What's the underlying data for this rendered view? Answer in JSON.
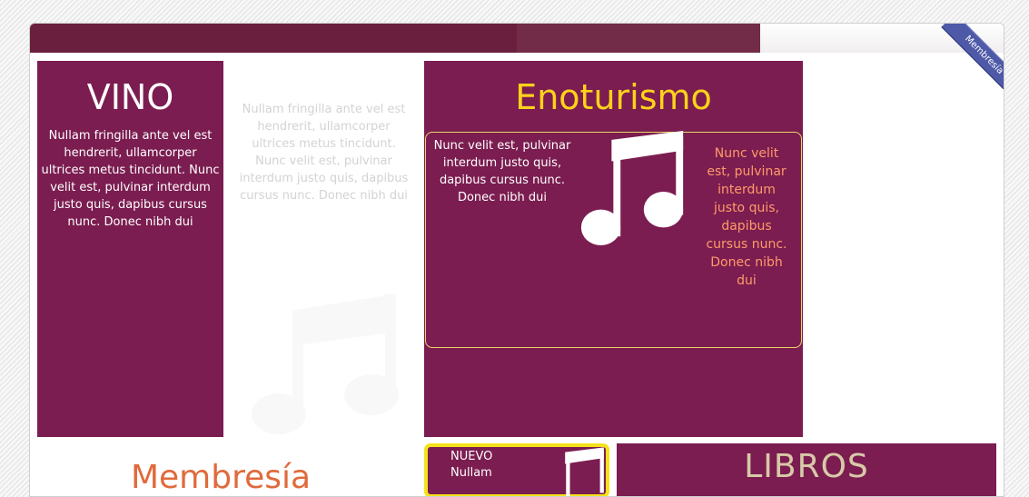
{
  "ribbon": {
    "label": "Membresía"
  },
  "tiles": {
    "vino": {
      "title": "VINO",
      "text": "Nullam fringilla ante vel est hendrerit, ullamcorper ultrices metus tincidunt. Nunc velit est, pulvinar interdum justo quis, dapibus cursus nunc. Donec nibh dui"
    },
    "ghost": {
      "text": "Nullam fringilla ante vel est hendrerit, ullamcorper ultrices metus tincidunt. Nunc velit est, pulvinar interdum justo quis, dapibus cursus nunc. Donec nibh dui"
    },
    "enoturismo": {
      "title": "Enoturismo",
      "text_left": "Nunc velit est, pulvinar interdum justo quis, dapibus cursus nunc. Donec nibh dui",
      "text_right": "Nunc velit est, pulvinar interdum justo quis, dapibus cursus nunc. Donec nibh dui"
    },
    "nuevo": {
      "label": "NUEVO",
      "text": "Nullam"
    },
    "libros": {
      "title": "LIBROS"
    },
    "bottom_left": {
      "title": "Membresía"
    }
  },
  "icons": {
    "music": "music-note-icon"
  },
  "colors": {
    "purple": "#7b1d50",
    "topbar": "#6b1f3f",
    "gold": "#ffd21a",
    "orange": "#ff9a6a",
    "ribbon": "#4e59a8"
  }
}
